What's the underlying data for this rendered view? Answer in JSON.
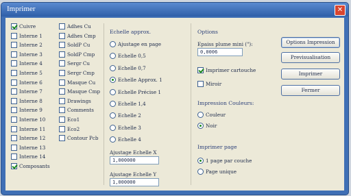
{
  "window": {
    "title": "Imprimer",
    "close_icon": "close-icon"
  },
  "layers": {
    "col1": [
      {
        "label": "Cuivre",
        "checked": true
      },
      {
        "label": "Interne 1",
        "checked": false
      },
      {
        "label": "Interne 2",
        "checked": false
      },
      {
        "label": "Interne 3",
        "checked": false
      },
      {
        "label": "Interne 4",
        "checked": false
      },
      {
        "label": "Interne 5",
        "checked": false
      },
      {
        "label": "Interne 6",
        "checked": false
      },
      {
        "label": "Interne 7",
        "checked": false
      },
      {
        "label": "Interne 8",
        "checked": false
      },
      {
        "label": "Interne 9",
        "checked": false
      },
      {
        "label": "Interne 10",
        "checked": false
      },
      {
        "label": "Interne 11",
        "checked": false
      },
      {
        "label": "Interne 12",
        "checked": false
      },
      {
        "label": "Interne 13",
        "checked": false
      },
      {
        "label": "Interne 14",
        "checked": false
      },
      {
        "label": "Composants",
        "checked": true
      }
    ],
    "col2": [
      {
        "label": "Adhes Cu",
        "checked": false
      },
      {
        "label": "Adhes Cmp",
        "checked": false
      },
      {
        "label": "SoldP Cu",
        "checked": false
      },
      {
        "label": "SoldP Cmp",
        "checked": false
      },
      {
        "label": "Sergr Cu",
        "checked": false
      },
      {
        "label": "Sergr Cmp",
        "checked": false
      },
      {
        "label": "Masque Cu",
        "checked": false
      },
      {
        "label": "Masque Cmp",
        "checked": false
      },
      {
        "label": "Drawings",
        "checked": false
      },
      {
        "label": "Comments",
        "checked": false
      },
      {
        "label": "Eco1",
        "checked": false
      },
      {
        "label": "Eco2",
        "checked": false
      },
      {
        "label": "Contour Pcb",
        "checked": false
      }
    ]
  },
  "scale": {
    "header": "Echelle approx.",
    "options": [
      {
        "label": "Ajustage en page",
        "selected": false
      },
      {
        "label": "Echelle 0,5",
        "selected": false
      },
      {
        "label": "Echelle 0,7",
        "selected": false
      },
      {
        "label": "Echelle Approx. 1",
        "selected": true
      },
      {
        "label": "Echelle Précise 1",
        "selected": false
      },
      {
        "label": "Echelle 1,4",
        "selected": false
      },
      {
        "label": "Echelle 2",
        "selected": false
      },
      {
        "label": "Echelle 3",
        "selected": false
      },
      {
        "label": "Echelle 4",
        "selected": false
      }
    ],
    "adjust_x_label": "Ajustage Echelle X",
    "adjust_x_value": "1,000000",
    "adjust_y_label": "Ajustage Echelle Y",
    "adjust_y_value": "1,000000"
  },
  "options": {
    "header": "Options",
    "pen_label": "Epaiss plume mini (\"):",
    "pen_value": "0,0006",
    "print_cartouche": {
      "label": "Imprimer cartouche",
      "checked": true
    },
    "mirror": {
      "label": "Miroir",
      "checked": false
    },
    "color_header": "Impression Couleurs:",
    "colors": [
      {
        "label": "Couleur",
        "selected": false
      },
      {
        "label": "Noir",
        "selected": true
      }
    ],
    "page_header": "Imprimer page",
    "pages": [
      {
        "label": "1 page par couche",
        "selected": true
      },
      {
        "label": "Page unique",
        "selected": false
      }
    ]
  },
  "buttons": {
    "options_impression": "Options Impression",
    "previsualisation": "Previsualisation",
    "imprimer": "Imprimer",
    "fermer": "Fermer"
  }
}
